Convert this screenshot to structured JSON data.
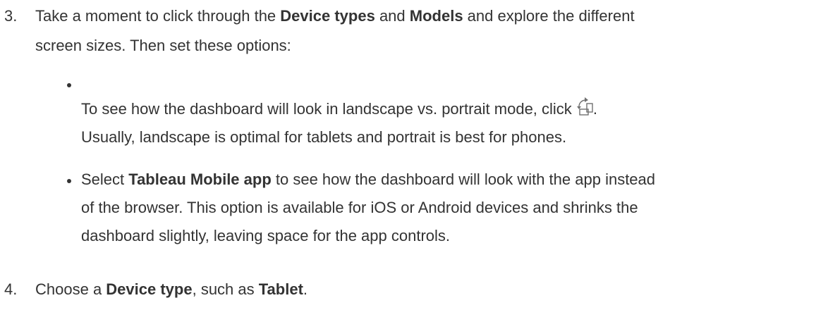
{
  "steps": [
    {
      "number": "3.",
      "parts": {
        "t1": "Take a moment to click through the ",
        "b1": "Device types",
        "t2": " and ",
        "b2": "Models",
        "t3": " and explore the different",
        "line2": "screen sizes. Then set these options:"
      },
      "bullets": [
        {
          "line1": "To see how the dashboard will look in landscape vs. portrait mode, click ",
          "icon": "rotate-orientation-icon",
          "line1_end": ".",
          "line2": "Usually, landscape is optimal for tablets and portrait is best for phones."
        },
        {
          "t1": "Select ",
          "b1": "Tableau Mobile app",
          "t2": " to see how the dashboard will look with the app instead",
          "line2": "of the browser. This option is available for iOS or Android devices and shrinks the",
          "line3": "dashboard slightly, leaving space for the app controls."
        }
      ]
    },
    {
      "number": "4.",
      "parts": {
        "t1": "Choose a ",
        "b1": "Device type",
        "t2": ", such as ",
        "b2": "Tablet",
        "t3": "."
      }
    }
  ]
}
